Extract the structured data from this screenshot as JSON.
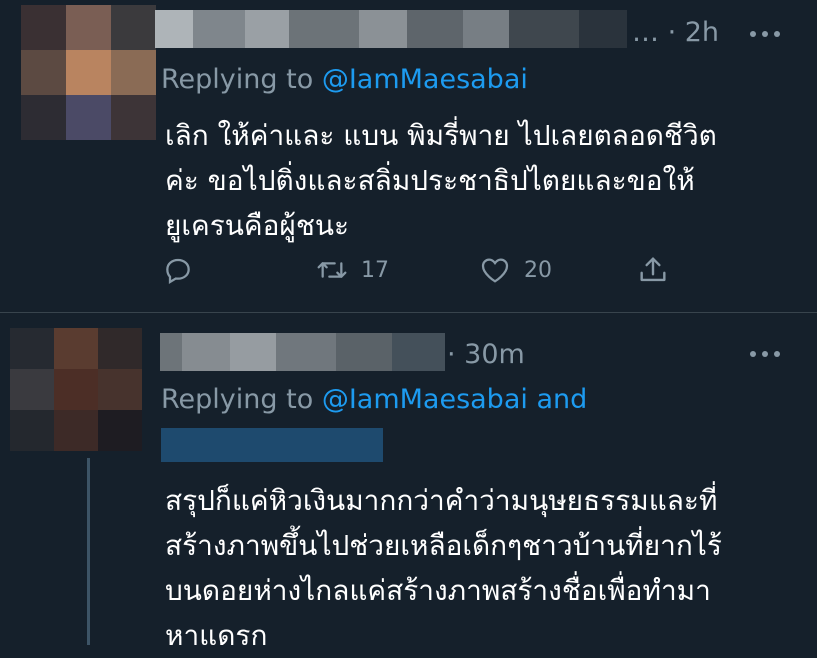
{
  "tweets": [
    {
      "time": "2h",
      "replying_prefix": "Replying to",
      "replying_handle": "@IamMaesabai",
      "replying_suffix": "",
      "lines": [
        "เลิก ให้ค่าและ แบน พิมรี่พาย ไปเลยตลอดชีวิต",
        "ค่ะ ขอไปติ่งและสลิ่มประชาธิปไตยและขอให้",
        "ยูเครนคือผู้ชนะ"
      ],
      "actions": {
        "retweets": "17",
        "likes": "20"
      }
    },
    {
      "time": "30m",
      "replying_prefix": "Replying to",
      "replying_handle": "@IamMaesabai and",
      "lines": [
        "สรุปก็แค่หิวเงินมากกว่าคำว่ามนุษยธรรมและที่",
        "สร้างภาพขึ้นไปช่วยเหลือเด็กๆชาวบ้านที่ยากไร้",
        "บนดอยห่างไกลแค่สร้างภาพสร้างชื่อเพื่อทำมา",
        "หาแดรก"
      ]
    }
  ],
  "icons": [
    "reply-icon",
    "retweet-icon",
    "like-icon",
    "share-icon",
    "more-icon"
  ],
  "colors": {
    "background": "#15202b",
    "muted": "#8899a6",
    "link": "#1d9bf0",
    "separator": "#38444d"
  }
}
